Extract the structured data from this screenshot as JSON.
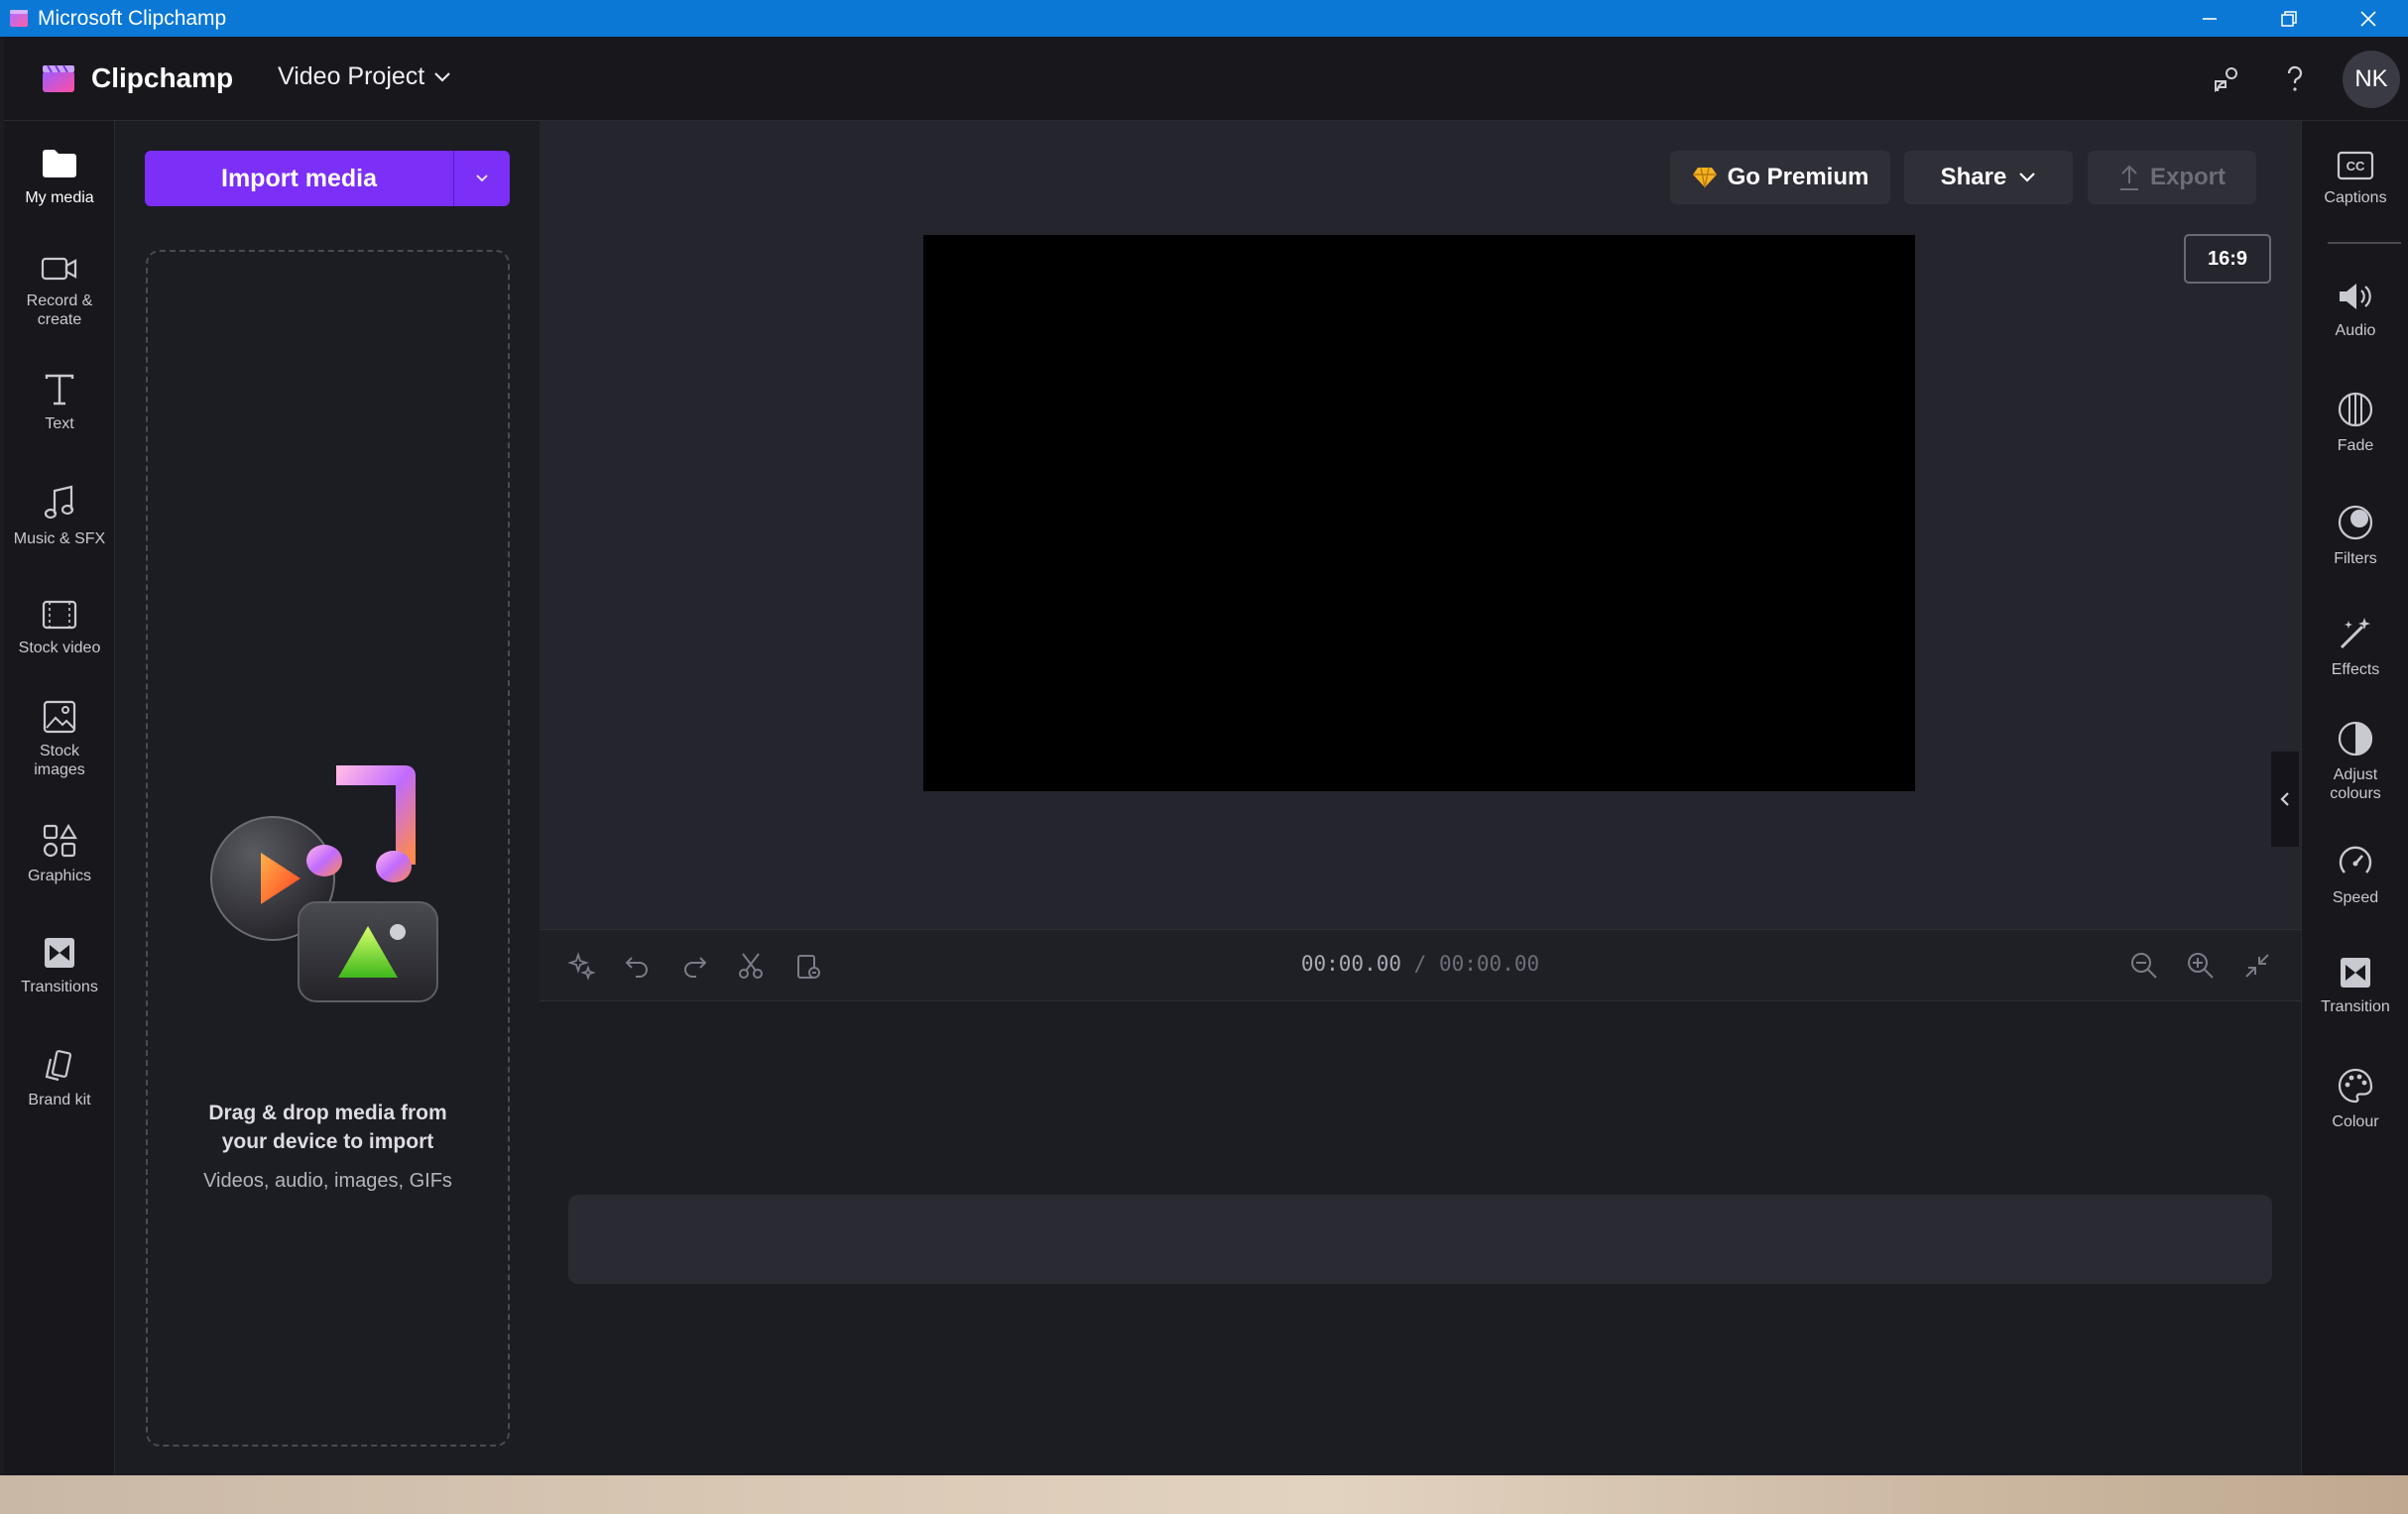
{
  "window": {
    "title": "Microsoft Clipchamp"
  },
  "header": {
    "brand": "Clipchamp",
    "project_name": "Video Project",
    "avatar_initials": "NK"
  },
  "left_nav": {
    "items": [
      {
        "label": "My media",
        "icon": "folder-icon"
      },
      {
        "label": "Record &\ncreate",
        "icon": "video-camera-icon"
      },
      {
        "label": "Text",
        "icon": "text-icon"
      },
      {
        "label": "Music & SFX",
        "icon": "music-note-icon"
      },
      {
        "label": "Stock video",
        "icon": "film-icon"
      },
      {
        "label": "Stock\nimages",
        "icon": "image-icon"
      },
      {
        "label": "Graphics",
        "icon": "shapes-icon"
      },
      {
        "label": "Transitions",
        "icon": "transition-icon"
      },
      {
        "label": "Brand kit",
        "icon": "brand-kit-icon"
      }
    ]
  },
  "media_panel": {
    "import_label": "Import media",
    "drop_title": "Drag & drop media from your device to import",
    "drop_subtitle": "Videos, audio, images, GIFs"
  },
  "stage": {
    "go_premium_label": "Go Premium",
    "share_label": "Share",
    "export_label": "Export",
    "aspect_ratio": "16:9"
  },
  "timeline": {
    "current_time": "00:00.00",
    "separator": "/",
    "total_time": "00:00.00"
  },
  "right_panel": {
    "items": [
      {
        "label": "Captions",
        "icon": "captions-icon"
      },
      {
        "label": "Audio",
        "icon": "speaker-icon"
      },
      {
        "label": "Fade",
        "icon": "fade-icon"
      },
      {
        "label": "Filters",
        "icon": "filters-icon"
      },
      {
        "label": "Effects",
        "icon": "magic-wand-icon"
      },
      {
        "label": "Adjust\ncolours",
        "icon": "half-circle-icon"
      },
      {
        "label": "Speed",
        "icon": "speedometer-icon"
      },
      {
        "label": "Transition",
        "icon": "transition-icon"
      },
      {
        "label": "Colour",
        "icon": "palette-icon"
      }
    ]
  },
  "colors": {
    "accent": "#7b2ff7",
    "titlebar": "#0b78d6",
    "premium_gem": "#f4b223"
  }
}
